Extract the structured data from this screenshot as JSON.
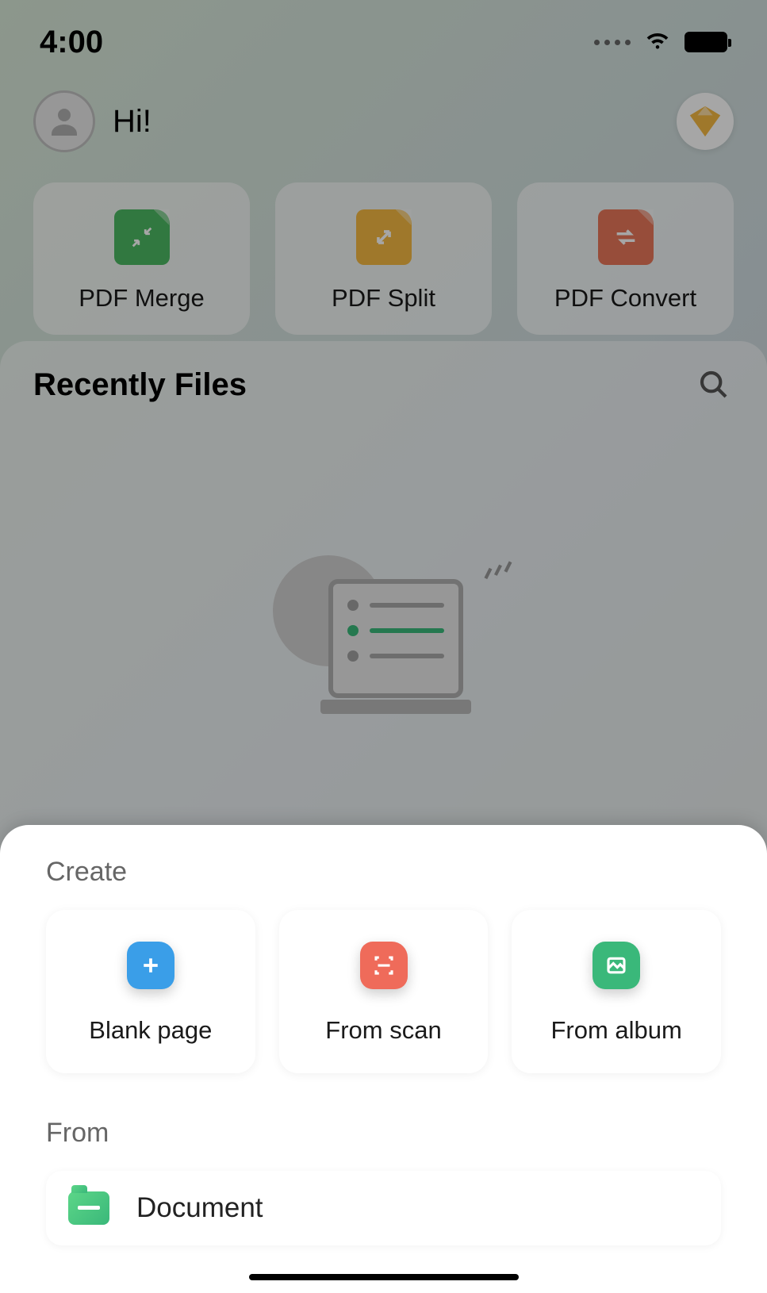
{
  "status": {
    "time": "4:00"
  },
  "header": {
    "greeting": "Hi!"
  },
  "tools": [
    {
      "label": "PDF Merge",
      "icon": "merge",
      "color": "#4cb963"
    },
    {
      "label": "PDF Split",
      "icon": "split",
      "color": "#f4b942"
    },
    {
      "label": "PDF Convert",
      "icon": "convert",
      "color": "#e8775a"
    }
  ],
  "files": {
    "title": "Recently Files"
  },
  "sheet": {
    "create_title": "Create",
    "create_options": [
      {
        "label": "Blank page",
        "icon": "blank",
        "color": "#3a9ee8"
      },
      {
        "label": "From scan",
        "icon": "scan",
        "color": "#ef6b5a"
      },
      {
        "label": "From album",
        "icon": "album",
        "color": "#3ab87a"
      }
    ],
    "from_title": "From",
    "from_options": [
      {
        "label": "Document",
        "icon": "folder"
      }
    ]
  }
}
